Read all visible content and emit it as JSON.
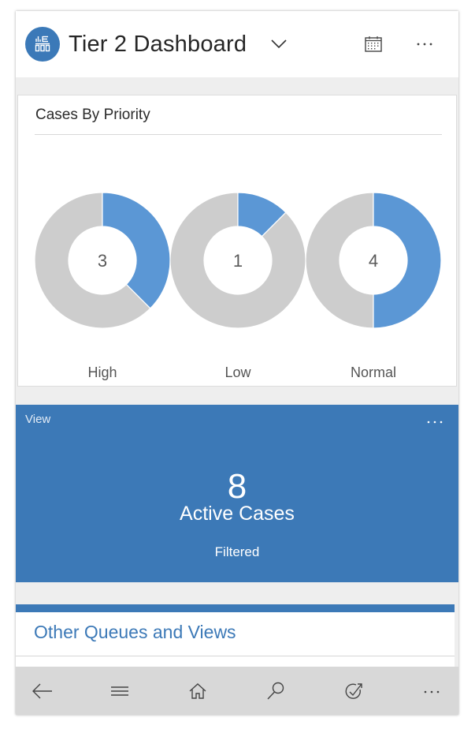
{
  "header": {
    "app_icon": "dashboard-icon",
    "title": "Tier 2 Dashboard",
    "dropdown_icon": "chevron-down-icon",
    "calendar_icon": "calendar-icon",
    "more_icon": "more-horizontal-icon"
  },
  "chart_card": {
    "title": "Cases By Priority"
  },
  "chart_data": {
    "type": "pie",
    "title": "Cases By Priority",
    "style": "donut-per-category",
    "categories": [
      "High",
      "Low",
      "Normal"
    ],
    "values": [
      3,
      1,
      4
    ],
    "total": 8,
    "center_labels": [
      "3",
      "1",
      "4"
    ],
    "colors": {
      "highlight": "#5b97d5",
      "remainder": "#cdcdcd"
    },
    "legend": "none"
  },
  "view_tile": {
    "caption": "View",
    "count": "8",
    "label": "Active Cases",
    "filter_label": "Filtered",
    "more_icon": "more-horizontal-icon",
    "background": "#3c79b7"
  },
  "queues": {
    "title": "Other Queues and Views",
    "accent": "#3c79b7"
  },
  "navbar": {
    "items": [
      {
        "name": "back",
        "icon": "arrow-left-icon"
      },
      {
        "name": "menu",
        "icon": "hamburger-icon"
      },
      {
        "name": "home",
        "icon": "home-icon"
      },
      {
        "name": "search",
        "icon": "search-icon"
      },
      {
        "name": "activities",
        "icon": "task-check-icon"
      },
      {
        "name": "more",
        "icon": "more-horizontal-icon"
      }
    ]
  }
}
